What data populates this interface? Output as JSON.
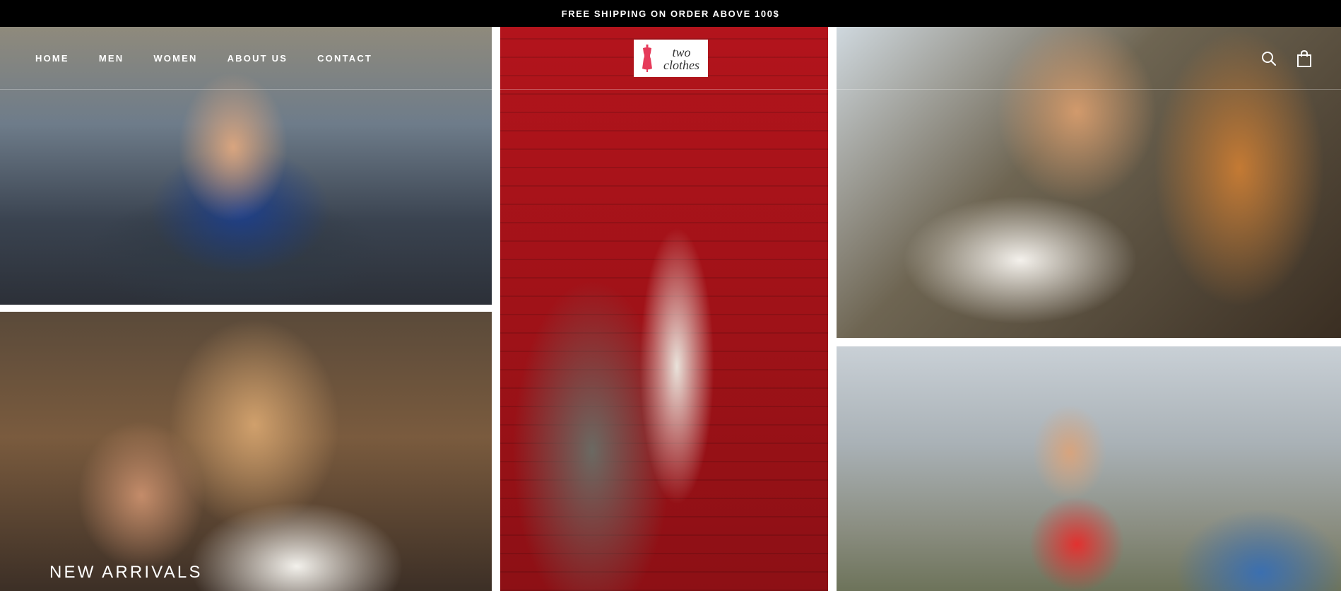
{
  "announcement": {
    "text": "FREE SHIPPING ON ORDER ABOVE 100$"
  },
  "nav": {
    "items": [
      {
        "label": "HOME"
      },
      {
        "label": "MEN"
      },
      {
        "label": "WOMEN"
      },
      {
        "label": "ABOUT US"
      },
      {
        "label": "CONTACT"
      }
    ]
  },
  "logo": {
    "line1": "two",
    "line2": "clothes",
    "icon": "dress-form-icon",
    "accent": "#e63a5a"
  },
  "header_icons": {
    "search": "search-icon",
    "cart": "shopping-bag-icon"
  },
  "hero": {
    "tiles": [
      {
        "name": "woman-blue-shirt-photo"
      },
      {
        "name": "couple-sunglasses-photo"
      },
      {
        "name": "woman-brick-wall-photo"
      },
      {
        "name": "man-white-shirt-photo"
      },
      {
        "name": "woman-swing-photo"
      }
    ],
    "caption": "NEW ARRIVALS"
  },
  "colors": {
    "announcement_bg": "#000000",
    "text_light": "#ffffff"
  }
}
